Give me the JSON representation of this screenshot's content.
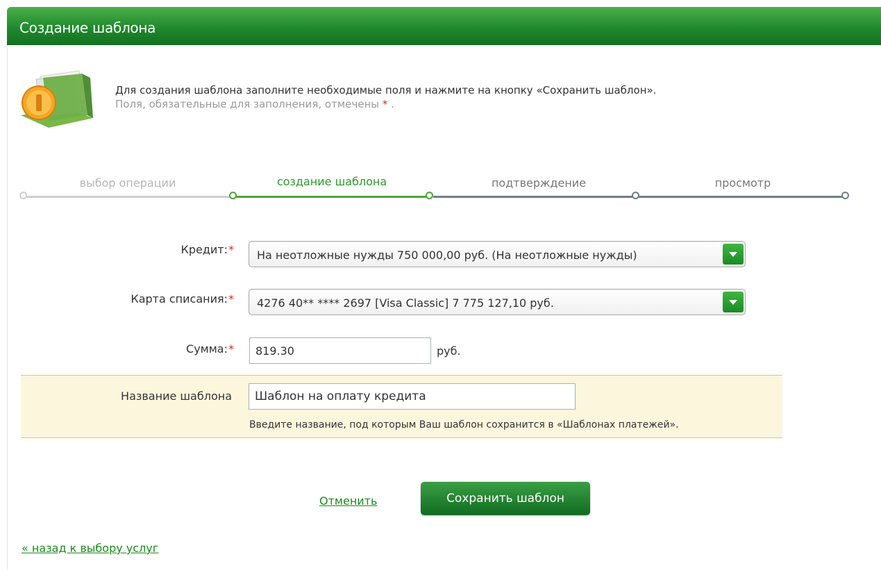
{
  "header": {
    "title": "Создание шаблона"
  },
  "intro": {
    "line1": "Для создания шаблона заполните необходимые поля и нажмите на кнопку «Сохранить шаблон».",
    "line2": "Поля, обязательные для заполнения, отмечены",
    "line2_star": "*",
    "line2_end": "."
  },
  "steps": [
    {
      "label": "выбор операции",
      "state": "done"
    },
    {
      "label": "создание шаблона",
      "state": "active"
    },
    {
      "label": "подтверждение",
      "state": "pending"
    },
    {
      "label": "просмотр",
      "state": "pending"
    }
  ],
  "form": {
    "required_mark": "*",
    "credit": {
      "label": "Кредит:",
      "value": "На неотложные нужды  750 000,00  руб.  (На неотложные нужды)"
    },
    "card": {
      "label": "Карта списания:",
      "value": "4276 40** **** 2697  [Visa Classic] 7 775 127,10  руб."
    },
    "amount": {
      "label": "Сумма:",
      "value": "819.30",
      "unit": "руб."
    },
    "template_name": {
      "label": "Название шаблона",
      "value": "Шаблон на оплату кредита",
      "hint": "Введите название, под которым Ваш шаблон сохранится в «Шаблонах платежей»."
    }
  },
  "actions": {
    "cancel": "Отменить",
    "save": "Сохранить шаблон"
  },
  "footer": {
    "back_link": "« назад к выбору услуг"
  },
  "colors": {
    "brand_green": "#1f8a2c",
    "active_step": "#4ca53a",
    "pending_step": "#6e7f8a",
    "done_step": "#cfcfcf",
    "required": "#e0241b",
    "highlight_band": "#fcf6dd"
  }
}
